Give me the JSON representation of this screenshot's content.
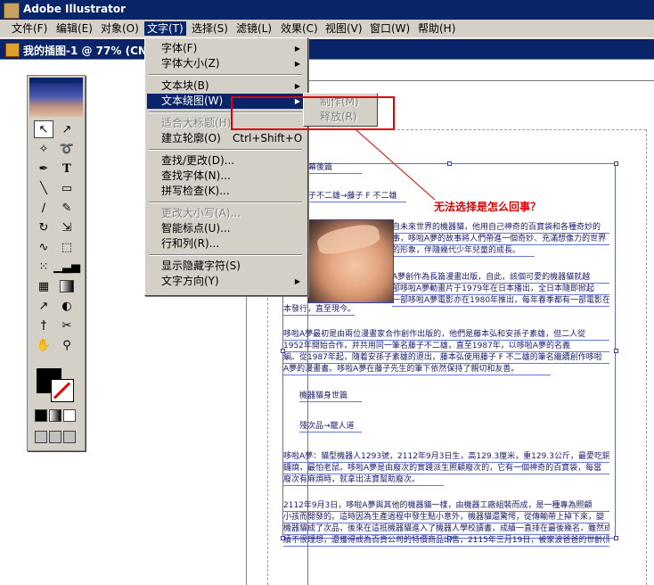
{
  "app": {
    "title": "Adobe Illustrator"
  },
  "menubar": [
    {
      "label": "文件(F)"
    },
    {
      "label": "编辑(E)"
    },
    {
      "label": "对象(O)"
    },
    {
      "label": "文字(T)"
    },
    {
      "label": "选择(S)"
    },
    {
      "label": "滤镜(L)"
    },
    {
      "label": "效果(C)"
    },
    {
      "label": "视图(V)"
    },
    {
      "label": "窗口(W)"
    },
    {
      "label": "帮助(H)"
    }
  ],
  "document": {
    "title": "我的插图-1 @ 77% (CN"
  },
  "type_menu": {
    "items": [
      {
        "label": "字体(F)",
        "submenu": true
      },
      {
        "label": "字体大小(Z)",
        "submenu": true
      },
      {
        "label": "文本块(B)",
        "submenu": true
      },
      {
        "label": "文本绕图(W)",
        "submenu": true,
        "highlighted": true
      },
      {
        "label": "适合大标题(H)",
        "disabled": true
      },
      {
        "label": "建立轮廓(O)",
        "shortcut": "Ctrl+Shift+O"
      },
      {
        "label": "查找/更改(D)..."
      },
      {
        "label": "查找字体(N)..."
      },
      {
        "label": "拼写检查(K)..."
      },
      {
        "label": "更改大小写(A)...",
        "disabled": true
      },
      {
        "label": "智能标点(U)..."
      },
      {
        "label": "行和列(R)..."
      },
      {
        "label": "显示隐藏字符(S)"
      },
      {
        "label": "文字方向(Y)",
        "submenu": true
      }
    ]
  },
  "wrap_submenu": {
    "items": [
      {
        "label": "制作(M)",
        "disabled": true
      },
      {
        "label": "释放(R)",
        "disabled": true
      }
    ]
  },
  "annotation": {
    "text": "无法选择是怎么回事？",
    "color": "#e00000"
  },
  "article": {
    "lines": [
      "幕後篇",
      "子不二雄→藤子 F 不二雄",
      "自未來世界的機器貓，他用自己神奇的百寶袋和各種奇妙的",
      "事，哆啦A夢的故事將人們帶進一個奇妙、充滿想像力的世界",
      "的形象，伴隨幾代少年兒童的成長。",
      "A夢創作為長篇漫畫出版，自此，該個可愛的機器貓就越",
      "部哆啦A夢動畫片于1979年在日本播出，全日本隨即掀起",
      "一部哆啦A夢電影亦在1980年推出，每年春季都有一部電影在日",
      "本發行，直至現今。",
      "哆啦A夢最初是由兩位漫畫家合作創作出版的，他們是藤本弘和安孫子素雄，但二人從",
      "1952年開始合作，并共用同一筆名藤子不二雄，直至1987年，以哆啦A夢的名義",
      "編。從1987年起，隨着安孫子素雄的退出，藤本弘使用藤子 F 不二雄的筆名繼續創作哆啦",
      "A夢的漫畫書。哆啦A夢在藤子先生的筆下依然保持了親切和友善。",
      "機器貓身世篇",
      "殘次品→寵人道",
      "哆啦A夢：貓型機器人1293號，2112年9月3日生，高129.3厘米，重129.3公斤，最愛吃銅",
      "鑼燒，最怕老鼠。哆啦A夢是由廢次的實踐派生照顧廢次的，它有一個神奇的百寶袋，每當",
      "廢次有麻煩時，就拿出法寶幫助廢次。",
      "2112年9月3日，哆啦A夢與其他的機器貓一樣，由機器工廠組裝而成，是一種專為照顧",
      "小孩而開發的。這時因為生產過程中發生點小意外，機器貓還驚愕，從傳輸帶上掉下來，變",
      "機器貓成了次品，後來在這抵機器貓進入了機器人學校讀書，成績一直排在最後幾名，雖然成",
      "績不很理想，還獲得成為百貨公司的特價商品出售，2115年三月19日，被家波爸爸的世齡(隨"
    ]
  },
  "colors": {
    "titlebar": "#0a246a",
    "menu_bg": "#d4d0c8",
    "highlight": "#0a246a",
    "annotation": "#e00000",
    "frame": "#5a6ad8"
  },
  "icons": [
    "selection-arrow-icon",
    "direct-select-icon",
    "magic-wand-icon",
    "lasso-icon",
    "pen-icon",
    "type-icon",
    "line-icon",
    "rectangle-icon",
    "paintbrush-icon",
    "pencil-icon",
    "rotate-icon",
    "scale-icon",
    "warp-icon",
    "free-transform-icon",
    "symbol-sprayer-icon",
    "column-graph-icon",
    "mesh-icon",
    "gradient-icon",
    "eyedropper-icon",
    "blend-icon",
    "slice-icon",
    "scissors-icon",
    "hand-icon",
    "zoom-icon"
  ]
}
